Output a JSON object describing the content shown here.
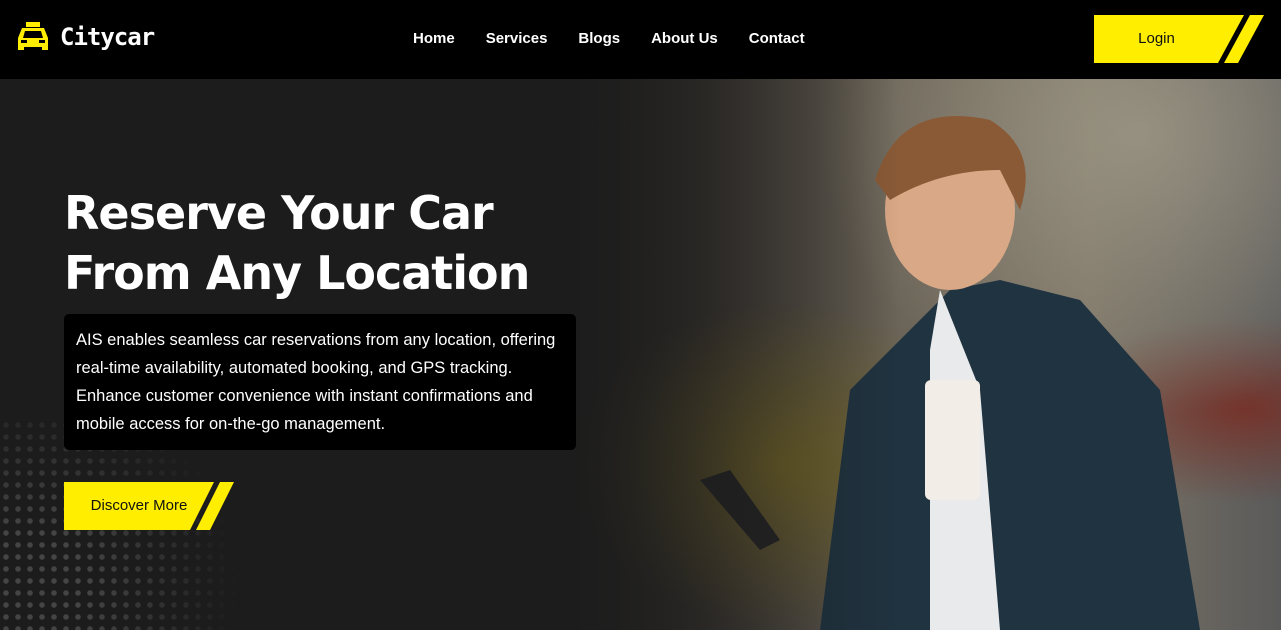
{
  "brand": {
    "name": "Citycar",
    "accent": "#FFEE00"
  },
  "nav": {
    "items": [
      "Home",
      "Services",
      "Blogs",
      "About Us",
      "Contact"
    ],
    "login": "Login"
  },
  "hero": {
    "title_line1": "Reserve Your Car",
    "title_line2": "From Any Location",
    "description": "AIS enables seamless car reservations from any location, offering real-time availability, automated booking, and GPS tracking. Enhance customer convenience with instant confirmations and mobile access for on-the-go management.",
    "cta": "Discover More"
  }
}
